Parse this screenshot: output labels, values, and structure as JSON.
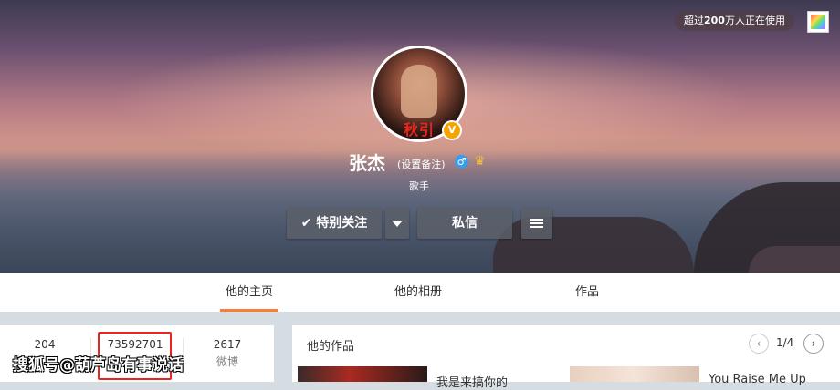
{
  "header": {
    "users_badge_prefix": "超过",
    "users_badge_count": "200",
    "users_badge_suffix": "万人正在使用",
    "skin_icon": "palette-icon"
  },
  "profile": {
    "avatar_text": "秋引",
    "verified_badge": "V",
    "name": "张杰",
    "remark_link": "(设置备注)",
    "gender_symbol": "♂",
    "member_icon": "crown-icon",
    "title": "歌手"
  },
  "actions": {
    "follow_label": "特别关注",
    "message_label": "私信"
  },
  "tabs": [
    {
      "label": "他的主页",
      "active": true
    },
    {
      "label": "他的相册",
      "active": false
    },
    {
      "label": "作品",
      "active": false
    }
  ],
  "counts": [
    {
      "number": "204",
      "label": ""
    },
    {
      "number": "73592701",
      "label": ""
    },
    {
      "number": "2617",
      "label": "微博"
    }
  ],
  "works": {
    "title": "他的作品",
    "pager": "1/4",
    "items": [
      {
        "title": "我是来搞你的"
      },
      {
        "title": "You Raise Me Up"
      }
    ]
  },
  "watermark": "搜狐号@葫芦岛有事说话",
  "colors": {
    "accent": "#fa7d3c",
    "highlight_box": "#e8261e",
    "verified": "#f6a400"
  }
}
